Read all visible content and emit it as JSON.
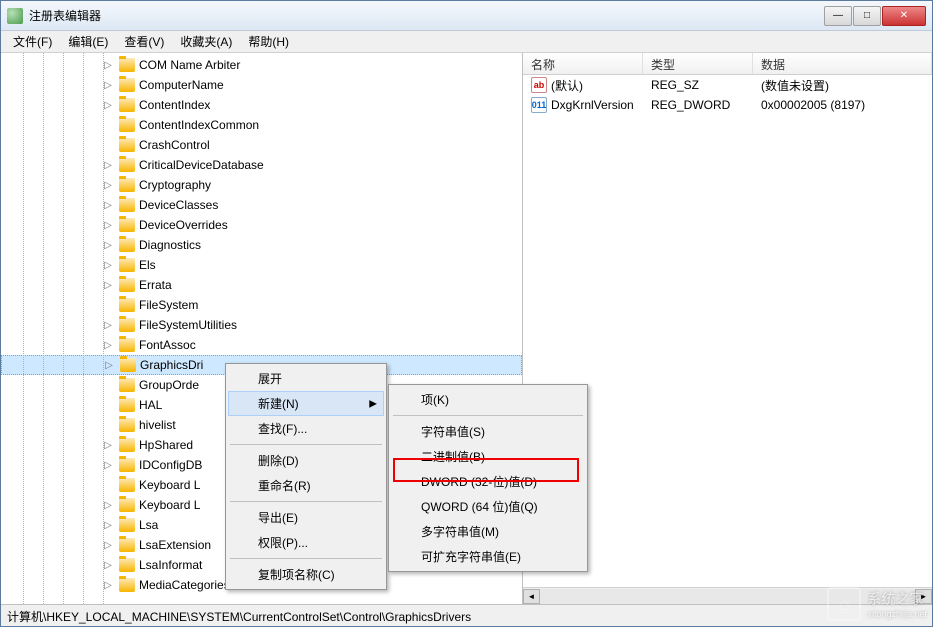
{
  "window": {
    "title": "注册表编辑器"
  },
  "menubar": [
    {
      "label": "文件(F)"
    },
    {
      "label": "编辑(E)"
    },
    {
      "label": "查看(V)"
    },
    {
      "label": "收藏夹(A)"
    },
    {
      "label": "帮助(H)"
    }
  ],
  "tree": {
    "items": [
      {
        "label": "COM Name Arbiter",
        "expandable": true
      },
      {
        "label": "ComputerName",
        "expandable": true
      },
      {
        "label": "ContentIndex",
        "expandable": true
      },
      {
        "label": "ContentIndexCommon",
        "expandable": false
      },
      {
        "label": "CrashControl",
        "expandable": false
      },
      {
        "label": "CriticalDeviceDatabase",
        "expandable": true
      },
      {
        "label": "Cryptography",
        "expandable": true
      },
      {
        "label": "DeviceClasses",
        "expandable": true
      },
      {
        "label": "DeviceOverrides",
        "expandable": true
      },
      {
        "label": "Diagnostics",
        "expandable": true
      },
      {
        "label": "Els",
        "expandable": true
      },
      {
        "label": "Errata",
        "expandable": true
      },
      {
        "label": "FileSystem",
        "expandable": false
      },
      {
        "label": "FileSystemUtilities",
        "expandable": true
      },
      {
        "label": "FontAssoc",
        "expandable": true
      },
      {
        "label": "GraphicsDri",
        "expandable": true,
        "selected": true
      },
      {
        "label": "GroupOrde",
        "expandable": false
      },
      {
        "label": "HAL",
        "expandable": false
      },
      {
        "label": "hivelist",
        "expandable": false
      },
      {
        "label": "HpShared",
        "expandable": true
      },
      {
        "label": "IDConfigDB",
        "expandable": true
      },
      {
        "label": "Keyboard L",
        "expandable": false
      },
      {
        "label": "Keyboard L",
        "expandable": true
      },
      {
        "label": "Lsa",
        "expandable": true
      },
      {
        "label": "LsaExtension",
        "expandable": true
      },
      {
        "label": "LsaInformat",
        "expandable": true
      },
      {
        "label": "MediaCategories",
        "expandable": true
      }
    ]
  },
  "list": {
    "headers": {
      "name": "名称",
      "type": "类型",
      "data": "数据"
    },
    "rows": [
      {
        "icon": "sz",
        "icon_text": "ab",
        "name": "(默认)",
        "type": "REG_SZ",
        "data": "(数值未设置)"
      },
      {
        "icon": "dw",
        "icon_text": "011",
        "name": "DxgKrnlVersion",
        "type": "REG_DWORD",
        "data": "0x00002005 (8197)"
      }
    ]
  },
  "context_menu_1": {
    "expand": "展开",
    "new": "新建(N)",
    "find": "查找(F)...",
    "delete": "删除(D)",
    "rename": "重命名(R)",
    "export": "导出(E)",
    "permissions": "权限(P)...",
    "copy_key_name": "复制项名称(C)"
  },
  "context_menu_2": {
    "key": "项(K)",
    "string": "字符串值(S)",
    "binary": "二进制值(B)",
    "dword": "DWORD (32-位)值(D)",
    "qword": "QWORD (64 位)值(Q)",
    "multi_string": "多字符串值(M)",
    "expandable_string": "可扩充字符串值(E)"
  },
  "statusbar": {
    "path": "计算机\\HKEY_LOCAL_MACHINE\\SYSTEM\\CurrentControlSet\\Control\\GraphicsDrivers"
  },
  "watermark": {
    "text": "系统之家",
    "url": "xitongzhijia.net"
  }
}
